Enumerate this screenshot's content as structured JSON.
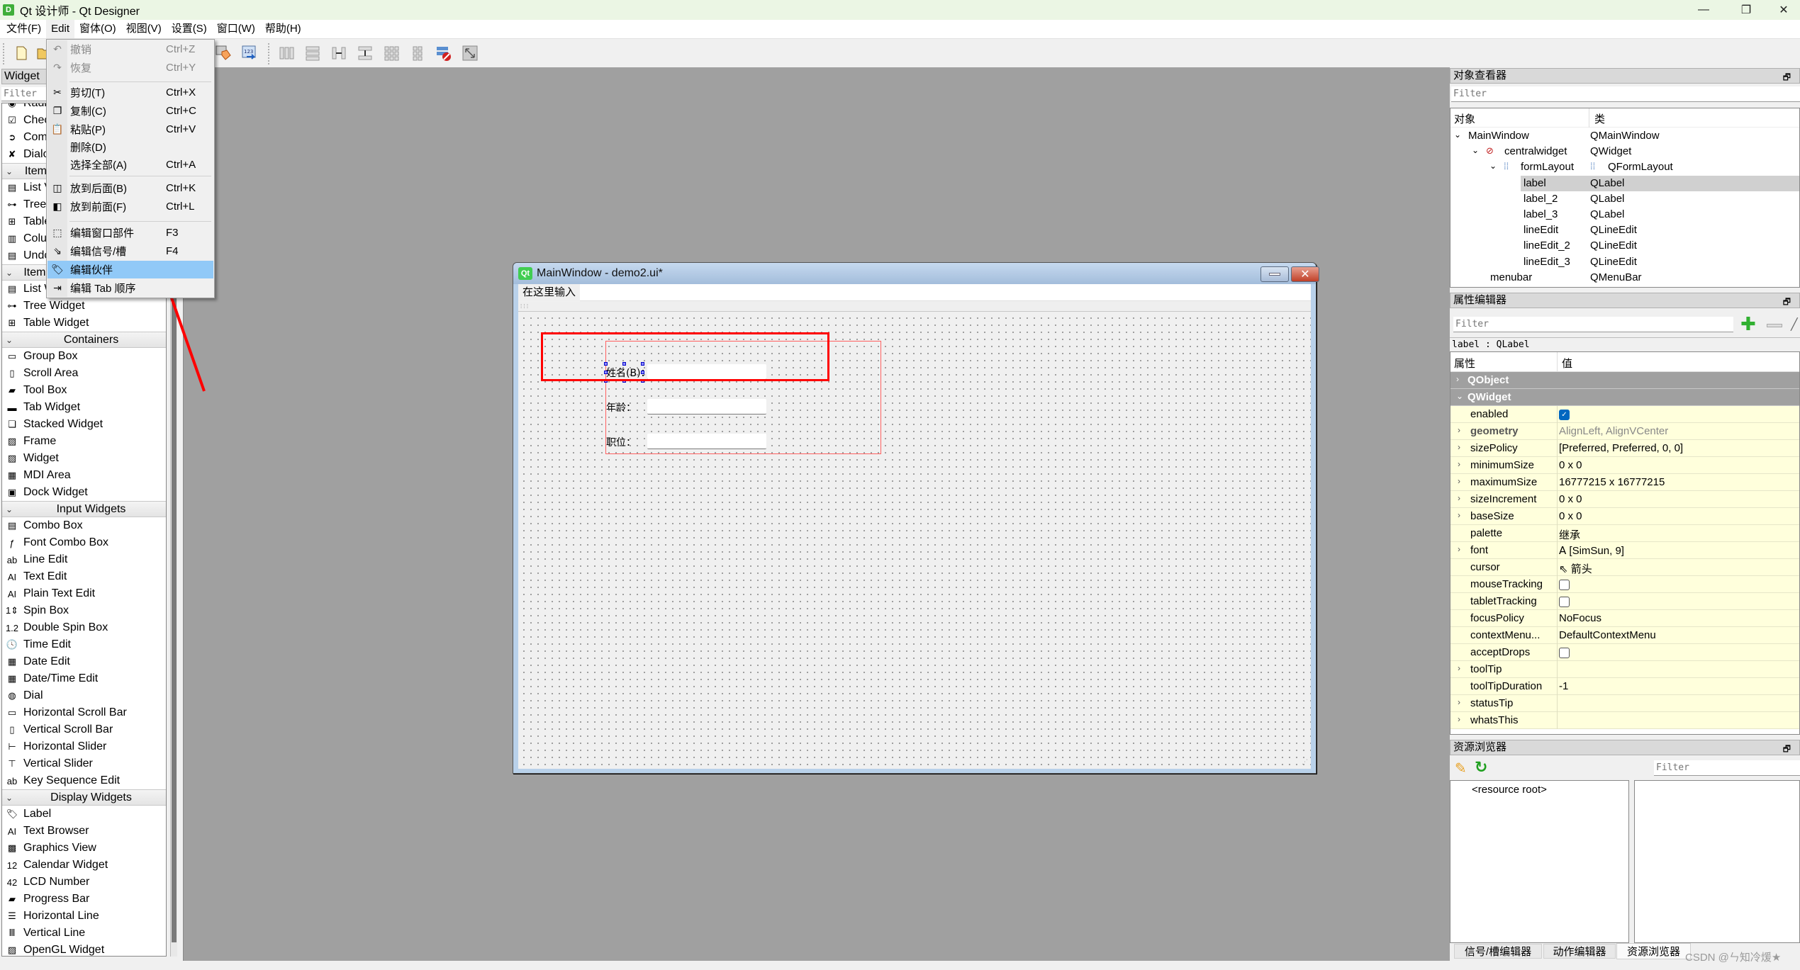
{
  "window": {
    "app_icon": "D",
    "title": "Qt 设计师 - Qt Designer",
    "controls": {
      "minimize": "—",
      "maximize": "❐",
      "close": "✕"
    }
  },
  "menubar": [
    "文件(F)",
    "Edit",
    "窗体(O)",
    "视图(V)",
    "设置(S)",
    "窗口(W)",
    "帮助(H)"
  ],
  "toolbar": {
    "icons": [
      "new-file-icon",
      "open-file-icon",
      "edit-buddies-icon",
      "edit-tab-order-icon",
      "layout-horizontal-icon",
      "layout-vertical-icon",
      "layout-horizontal-splitter-icon",
      "layout-vertical-splitter-icon",
      "layout-grid-icon",
      "layout-form-icon",
      "break-layout-icon",
      "adjust-size-icon"
    ]
  },
  "edit_menu": {
    "items": [
      {
        "label": "撤销",
        "shortcut": "Ctrl+Z",
        "icon": "undo-icon",
        "glyph": "↶",
        "disabled": true
      },
      {
        "label": "恢复",
        "shortcut": "Ctrl+Y",
        "icon": "redo-icon",
        "glyph": "↷",
        "disabled": true
      },
      {
        "label": "剪切(T)",
        "shortcut": "Ctrl+X",
        "icon": "cut-icon",
        "glyph": "✂"
      },
      {
        "label": "复制(C)",
        "shortcut": "Ctrl+C",
        "icon": "copy-icon",
        "glyph": "❐"
      },
      {
        "label": "粘贴(P)",
        "shortcut": "Ctrl+V",
        "icon": "paste-icon",
        "glyph": "📋"
      },
      {
        "label": "删除(D)",
        "shortcut": "",
        "icon": "",
        "glyph": ""
      },
      {
        "label": "选择全部(A)",
        "shortcut": "Ctrl+A",
        "icon": "",
        "glyph": ""
      },
      {
        "label": "放到后面(B)",
        "shortcut": "Ctrl+K",
        "icon": "send-to-back-icon",
        "glyph": "◫"
      },
      {
        "label": "放到前面(F)",
        "shortcut": "Ctrl+L",
        "icon": "bring-to-front-icon",
        "glyph": "◧"
      },
      {
        "label": "编辑窗口部件",
        "shortcut": "F3",
        "icon": "edit-widgets-icon",
        "glyph": "⬚"
      },
      {
        "label": "编辑信号/槽",
        "shortcut": "F4",
        "icon": "edit-signals-slots-icon",
        "glyph": "⇘"
      },
      {
        "label": "编辑伙伴",
        "shortcut": "",
        "icon": "edit-buddies-icon",
        "glyph": "🏷",
        "highlighted": true
      },
      {
        "label": "编辑 Tab 顺序",
        "shortcut": "",
        "icon": "edit-tab-order-icon",
        "glyph": "⇥"
      }
    ]
  },
  "widget_box": {
    "title": "Widget",
    "filter_placeholder": "Filter",
    "rows": [
      {
        "type": "item",
        "label": "Radio Button",
        "icon": "radio-button-icon",
        "glyph": "◉"
      },
      {
        "type": "item",
        "label": "Check Box",
        "icon": "check-box-icon",
        "glyph": "☑"
      },
      {
        "type": "item",
        "label": "Command Link Button",
        "icon": "command-link-icon",
        "glyph": "➲"
      },
      {
        "type": "item",
        "label": "Dialog Button Box",
        "icon": "dialog-button-box-icon",
        "glyph": "✘"
      },
      {
        "type": "category",
        "label": "Item Views (Model-Based)"
      },
      {
        "type": "item",
        "label": "List View",
        "icon": "list-view-icon",
        "glyph": "▤"
      },
      {
        "type": "item",
        "label": "Tree View",
        "icon": "tree-view-icon",
        "glyph": "⊶"
      },
      {
        "type": "item",
        "label": "Table View",
        "icon": "table-view-icon",
        "glyph": "⊞"
      },
      {
        "type": "item",
        "label": "Column View",
        "icon": "column-view-icon",
        "glyph": "▥"
      },
      {
        "type": "item",
        "label": "Undo View",
        "icon": "undo-view-icon",
        "glyph": "▤"
      },
      {
        "type": "category",
        "label": "Item Widgets (Item-Based)"
      },
      {
        "type": "item",
        "label": "List Widget",
        "icon": "list-widget-icon",
        "glyph": "▤"
      },
      {
        "type": "item",
        "label": "Tree Widget",
        "icon": "tree-widget-icon",
        "glyph": "⊶"
      },
      {
        "type": "item",
        "label": "Table Widget",
        "icon": "table-widget-icon",
        "glyph": "⊞"
      },
      {
        "type": "category",
        "label": "Containers"
      },
      {
        "type": "item",
        "label": "Group Box",
        "icon": "group-box-icon",
        "glyph": "▭"
      },
      {
        "type": "item",
        "label": "Scroll Area",
        "icon": "scroll-area-icon",
        "glyph": "▯"
      },
      {
        "type": "item",
        "label": "Tool Box",
        "icon": "tool-box-icon",
        "glyph": "▰"
      },
      {
        "type": "item",
        "label": "Tab Widget",
        "icon": "tab-widget-icon",
        "glyph": "▬"
      },
      {
        "type": "item",
        "label": "Stacked Widget",
        "icon": "stacked-widget-icon",
        "glyph": "❏"
      },
      {
        "type": "item",
        "label": "Frame",
        "icon": "frame-icon",
        "glyph": "▨"
      },
      {
        "type": "item",
        "label": "Widget",
        "icon": "widget-icon",
        "glyph": "▨"
      },
      {
        "type": "item",
        "label": "MDI Area",
        "icon": "mdi-area-icon",
        "glyph": "▦"
      },
      {
        "type": "item",
        "label": "Dock Widget",
        "icon": "dock-widget-icon",
        "glyph": "▣"
      },
      {
        "type": "category",
        "label": "Input Widgets"
      },
      {
        "type": "item",
        "label": "Combo Box",
        "icon": "combo-box-icon",
        "glyph": "▤"
      },
      {
        "type": "item",
        "label": "Font Combo Box",
        "icon": "font-combo-box-icon",
        "glyph": "ƒ"
      },
      {
        "type": "item",
        "label": "Line Edit",
        "icon": "line-edit-icon",
        "glyph": "ab"
      },
      {
        "type": "item",
        "label": "Text Edit",
        "icon": "text-edit-icon",
        "glyph": "AI"
      },
      {
        "type": "item",
        "label": "Plain Text Edit",
        "icon": "plain-text-edit-icon",
        "glyph": "AI"
      },
      {
        "type": "item",
        "label": "Spin Box",
        "icon": "spin-box-icon",
        "glyph": "1⇕"
      },
      {
        "type": "item",
        "label": "Double Spin Box",
        "icon": "double-spin-box-icon",
        "glyph": "1.2"
      },
      {
        "type": "item",
        "label": "Time Edit",
        "icon": "time-edit-icon",
        "glyph": "🕓"
      },
      {
        "type": "item",
        "label": "Date Edit",
        "icon": "date-edit-icon",
        "glyph": "▦"
      },
      {
        "type": "item",
        "label": "Date/Time Edit",
        "icon": "date-time-edit-icon",
        "glyph": "▦"
      },
      {
        "type": "item",
        "label": "Dial",
        "icon": "dial-icon",
        "glyph": "◍"
      },
      {
        "type": "item",
        "label": "Horizontal Scroll Bar",
        "icon": "horizontal-scroll-bar-icon",
        "glyph": "▭"
      },
      {
        "type": "item",
        "label": "Vertical Scroll Bar",
        "icon": "vertical-scroll-bar-icon",
        "glyph": "▯"
      },
      {
        "type": "item",
        "label": "Horizontal Slider",
        "icon": "horizontal-slider-icon",
        "glyph": "⊢"
      },
      {
        "type": "item",
        "label": "Vertical Slider",
        "icon": "vertical-slider-icon",
        "glyph": "⊤"
      },
      {
        "type": "item",
        "label": "Key Sequence Edit",
        "icon": "key-sequence-edit-icon",
        "glyph": "ab"
      },
      {
        "type": "category",
        "label": "Display Widgets"
      },
      {
        "type": "item",
        "label": "Label",
        "icon": "label-icon",
        "glyph": "🏷"
      },
      {
        "type": "item",
        "label": "Text Browser",
        "icon": "text-browser-icon",
        "glyph": "AI"
      },
      {
        "type": "item",
        "label": "Graphics View",
        "icon": "graphics-view-icon",
        "glyph": "▩"
      },
      {
        "type": "item",
        "label": "Calendar Widget",
        "icon": "calendar-widget-icon",
        "glyph": "12"
      },
      {
        "type": "item",
        "label": "LCD Number",
        "icon": "lcd-number-icon",
        "glyph": "42"
      },
      {
        "type": "item",
        "label": "Progress Bar",
        "icon": "progress-bar-icon",
        "glyph": "▰"
      },
      {
        "type": "item",
        "label": "Horizontal Line",
        "icon": "horizontal-line-icon",
        "glyph": "☰"
      },
      {
        "type": "item",
        "label": "Vertical Line",
        "icon": "vertical-line-icon",
        "glyph": "Ⅲ"
      },
      {
        "type": "item",
        "label": "OpenGL Widget",
        "icon": "opengl-widget-icon",
        "glyph": "▨"
      }
    ]
  },
  "form_window": {
    "qt_icon": "Qt",
    "title": "MainWindow - demo2.ui*",
    "menubar_placeholder": "在这里输入",
    "labels": [
      "姓名(B)：",
      "年龄：",
      "职位："
    ],
    "line_edits": [
      "",
      "",
      ""
    ]
  },
  "object_inspector": {
    "title": "对象查看器",
    "filter_placeholder": "Filter",
    "columns": [
      "对象",
      "类"
    ],
    "rows": [
      {
        "object": "MainWindow",
        "class": "QMainWindow",
        "depth": 0,
        "expanded": true
      },
      {
        "object": "centralwidget",
        "class": "QWidget",
        "depth": 1,
        "expanded": true,
        "icon": "broken-layout-icon"
      },
      {
        "object": "formLayout",
        "class": "QFormLayout",
        "depth": 2,
        "expanded": true,
        "icon": "form-layout-icon"
      },
      {
        "object": "label",
        "class": "QLabel",
        "depth": 3,
        "selected": true
      },
      {
        "object": "label_2",
        "class": "QLabel",
        "depth": 3
      },
      {
        "object": "label_3",
        "class": "QLabel",
        "depth": 3
      },
      {
        "object": "lineEdit",
        "class": "QLineEdit",
        "depth": 3
      },
      {
        "object": "lineEdit_2",
        "class": "QLineEdit",
        "depth": 3
      },
      {
        "object": "lineEdit_3",
        "class": "QLineEdit",
        "depth": 3
      },
      {
        "object": "menubar",
        "class": "QMenuBar",
        "depth": 1
      }
    ]
  },
  "property_editor": {
    "title": "属性编辑器",
    "filter_placeholder": "Filter",
    "selected_object": "label : QLabel",
    "columns": [
      "属性",
      "值"
    ],
    "rows": [
      {
        "type": "category",
        "name": "QObject",
        "expanded": false
      },
      {
        "type": "category",
        "name": "QWidget",
        "expanded": true
      },
      {
        "name": "enabled",
        "value": "",
        "checkbox": true,
        "checked": true
      },
      {
        "name": "geometry",
        "value": "AlignLeft, AlignVCenter",
        "expandable": true,
        "bold": true,
        "grey": true
      },
      {
        "name": "sizePolicy",
        "value": "[Preferred, Preferred, 0, 0]",
        "expandable": true
      },
      {
        "name": "minimumSize",
        "value": "0 x 0",
        "expandable": true
      },
      {
        "name": "maximumSize",
        "value": "16777215 x 16777215",
        "expandable": true
      },
      {
        "name": "sizeIncrement",
        "value": "0 x 0",
        "expandable": true
      },
      {
        "name": "baseSize",
        "value": "0 x 0",
        "expandable": true
      },
      {
        "name": "palette",
        "value": "继承"
      },
      {
        "name": "font",
        "value": "𝖠  [SimSun, 9]",
        "expandable": true
      },
      {
        "name": "cursor",
        "value": "⇖  箭头"
      },
      {
        "name": "mouseTracking",
        "value": "",
        "checkbox": true,
        "checked": false
      },
      {
        "name": "tabletTracking",
        "value": "",
        "checkbox": true,
        "checked": false
      },
      {
        "name": "focusPolicy",
        "value": "NoFocus"
      },
      {
        "name": "contextMenu...",
        "value": "DefaultContextMenu"
      },
      {
        "name": "acceptDrops",
        "value": "",
        "checkbox": true,
        "checked": false
      },
      {
        "name": "toolTip",
        "value": "",
        "expandable": true
      },
      {
        "name": "toolTipDuration",
        "value": "-1"
      },
      {
        "name": "statusTip",
        "value": "",
        "expandable": true
      },
      {
        "name": "whatsThis",
        "value": "",
        "expandable": true
      }
    ]
  },
  "resource_browser": {
    "title": "资源浏览器",
    "filter_placeholder": "Filter",
    "root": "<resource root>"
  },
  "bottom_tabs": [
    {
      "label": "信号/槽编辑器",
      "active": false
    },
    {
      "label": "动作编辑器",
      "active": false
    },
    {
      "label": "资源浏览器",
      "active": true
    }
  ],
  "watermark": "CSDN @ㄣ知冷煖★",
  "annotation": {
    "color": "#ff0000"
  }
}
